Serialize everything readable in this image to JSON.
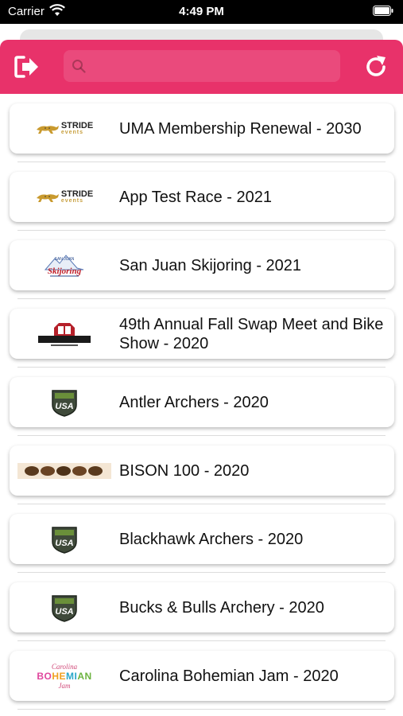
{
  "status_bar": {
    "carrier": "Carrier",
    "time": "4:49 PM"
  },
  "header": {
    "search_placeholder": "",
    "accent_color": "#e8326a",
    "icons": {
      "left": "logout-icon",
      "search": "search-icon",
      "right": "refresh-icon"
    }
  },
  "events": [
    {
      "title": "UMA Membership Renewal - 2030",
      "logo": "stride-events"
    },
    {
      "title": "App Test Race - 2021",
      "logo": "stride-events"
    },
    {
      "title": "San Juan Skijoring - 2021",
      "logo": "skijoring"
    },
    {
      "title": "49th Annual Fall Swap Meet and Bike Show - 2020",
      "logo": "cycling-association"
    },
    {
      "title": "Antler Archers - 2020",
      "logo": "usa-archery"
    },
    {
      "title": "BISON 100 - 2020",
      "logo": "bison-strip"
    },
    {
      "title": "Blackhawk Archers - 2020",
      "logo": "usa-archery"
    },
    {
      "title": "Bucks & Bulls Archery - 2020",
      "logo": "usa-archery"
    },
    {
      "title": "Carolina Bohemian Jam - 2020",
      "logo": "carolina-bohemian"
    }
  ],
  "logo_text": {
    "stride": "STRIDE",
    "stride_sub": "events",
    "skijoring_top": "SAN JUAN",
    "skijoring": "Skijoring",
    "usa": "USA",
    "carolina_top": "Carolina",
    "carolina_main": "BOHEMIAN",
    "carolina_bottom": "Jam"
  }
}
